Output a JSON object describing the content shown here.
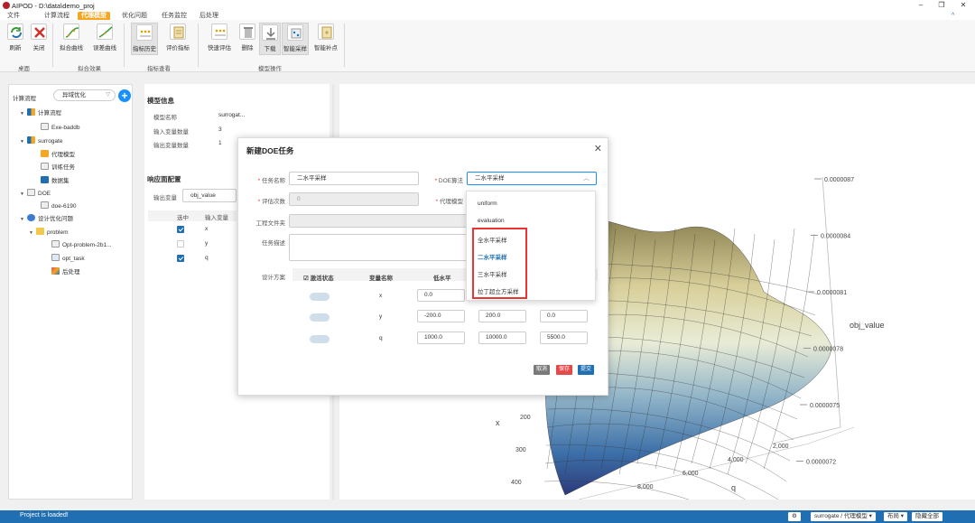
{
  "window": {
    "title": "AIPOD - D:\\data\\demo_proj",
    "controls": [
      "–",
      "❐",
      "✕"
    ]
  },
  "menu_tabs": [
    "文件",
    "计算流程",
    "代理模型",
    "优化问题",
    "任务监控",
    "后处理"
  ],
  "active_tab_index": 2,
  "ribbon": {
    "buttons": [
      "刷新",
      "关闭",
      "拟合曲线",
      "误差曲线",
      "指标历史",
      "评价指标",
      "快速评估",
      "删除",
      "下载",
      "智能采样",
      "智能补点"
    ],
    "groups": [
      "桌面",
      "拟合效果",
      "指标查看",
      "模型操作"
    ],
    "collapse": "^"
  },
  "sidebar": {
    "flow_label": "计算流程",
    "flow_select": "异域优化",
    "add": "+",
    "tree": [
      "计算流程",
      "Exe-baddb",
      "surrogate",
      "代理模型",
      "训练任务",
      "数据集",
      "DOE",
      "doe-6190",
      "设计优化问题",
      "problem",
      "Opt-problem-2b1...",
      "opt_task",
      "后处理"
    ]
  },
  "model_info": {
    "title": "模型信息",
    "name_label": "模型名称",
    "name_value": "surrogat...",
    "inputs_label": "输入变量数量",
    "inputs_value": "3",
    "outputs_label": "输出变量数量",
    "outputs_value": "1"
  },
  "response_config": {
    "title": "响应面配置",
    "output_label": "输出变量",
    "output_value": "obj_value",
    "col_selected": "选中",
    "col_input": "输入变量",
    "rows": [
      {
        "var": "x",
        "checked": true
      },
      {
        "var": "y",
        "checked": false
      },
      {
        "var": "q",
        "checked": true
      }
    ]
  },
  "chart_data": {
    "type": "surface",
    "axes": {
      "x": {
        "label": "x",
        "ticks": [
          "200",
          "300",
          "400"
        ]
      },
      "y": {
        "label": "q",
        "ticks": [
          "2,000",
          "4,000",
          "6,000",
          "8,000"
        ]
      },
      "z": {
        "label": "obj_value",
        "ticks": [
          "0.0000087",
          "0.0000084",
          "0.0000081",
          "0.0000078",
          "0.0000075",
          "0.0000072"
        ]
      }
    },
    "colorscale": [
      "#2c3a7a",
      "#3c6fa8",
      "#8fb3c8",
      "#e9ecd6",
      "#d8cf9a",
      "#8a8051"
    ]
  },
  "dialog": {
    "title": "新建DOE任务",
    "close": "✕",
    "task_name_label": "任务名称",
    "task_name_value": "二水平采样",
    "doe_algo_label": "DOE算法",
    "doe_algo_value": "二水平采样",
    "eval_count_label": "评估次数",
    "eval_count_value": "0",
    "surrogate_label": "代理模型",
    "project_folder_label": "工程文件夹",
    "task_desc_label": "任务描述",
    "design_label": "设计方案",
    "table_headers": [
      "激活状态",
      "变量名称",
      "低水平"
    ],
    "rows": [
      {
        "name": "x",
        "low": "0.0"
      },
      {
        "name": "y",
        "low": "-200.0",
        "high": "200.0",
        "mid": "0.0"
      },
      {
        "name": "q",
        "low": "1000.0",
        "high": "10000.0",
        "mid": "5500.0"
      }
    ],
    "buttons": {
      "cancel": "取消",
      "save": "保存",
      "submit": "提交"
    },
    "colors": {
      "cancel": "#7a7a7a",
      "save": "#e34a4a",
      "submit": "#1f6fb2"
    }
  },
  "dropdown": {
    "options": [
      "uniform",
      "evaluation",
      "全水平采样",
      "二水平采样",
      "三水平采样",
      "拉丁超立方采样"
    ],
    "selected_index": 3
  },
  "statusbar": {
    "text": "Project is loaded!",
    "gear": "⚙",
    "model_selector": "surrogate / 代理模型 ▾",
    "layout": "布局 ▾",
    "hide_all": "隐藏全部"
  }
}
